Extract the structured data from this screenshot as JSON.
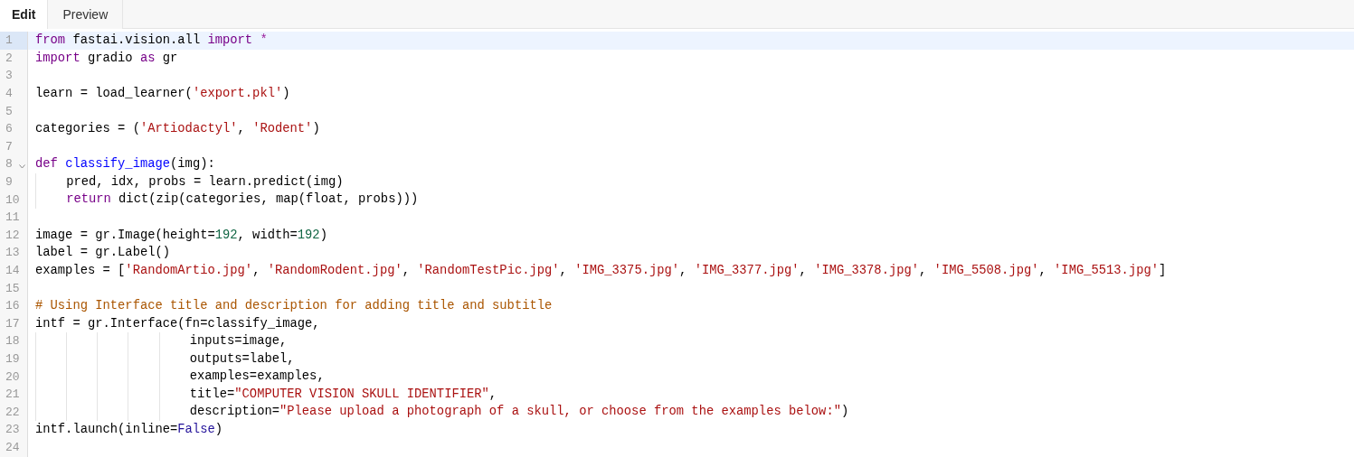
{
  "tabs": [
    {
      "label": "Edit",
      "selected": true
    },
    {
      "label": "Preview",
      "selected": false
    }
  ],
  "editor": {
    "lines": [
      {
        "number": "1",
        "active": true,
        "foldable": false,
        "tokens": [
          {
            "t": "from",
            "kind": "keyword"
          },
          {
            "t": " fastai.vision.all ",
            "kind": "plain"
          },
          {
            "t": "import",
            "kind": "keyword"
          },
          {
            "t": " *",
            "kind": "operator"
          }
        ]
      },
      {
        "number": "2",
        "active": false,
        "foldable": false,
        "tokens": [
          {
            "t": "import",
            "kind": "keyword"
          },
          {
            "t": " gradio ",
            "kind": "plain"
          },
          {
            "t": "as",
            "kind": "keyword"
          },
          {
            "t": " gr",
            "kind": "plain"
          }
        ]
      },
      {
        "number": "3",
        "active": false,
        "foldable": false
      },
      {
        "number": "4",
        "active": false,
        "foldable": false,
        "tokens": [
          {
            "t": "learn = load_learner(",
            "kind": "plain"
          },
          {
            "t": "'export.pkl'",
            "kind": "string"
          },
          {
            "t": ")",
            "kind": "plain"
          }
        ]
      },
      {
        "number": "5",
        "active": false,
        "foldable": false
      },
      {
        "number": "6",
        "active": false,
        "foldable": false,
        "tokens": [
          {
            "t": "categories = (",
            "kind": "plain"
          },
          {
            "t": "'Artiodactyl'",
            "kind": "string"
          },
          {
            "t": ", ",
            "kind": "plain"
          },
          {
            "t": "'Rodent'",
            "kind": "string"
          },
          {
            "t": ")",
            "kind": "plain"
          }
        ]
      },
      {
        "number": "7",
        "active": false,
        "foldable": false
      },
      {
        "number": "8",
        "active": false,
        "foldable": true,
        "tokens": [
          {
            "t": "def ",
            "kind": "keyword"
          },
          {
            "t": "classify_image",
            "kind": "def"
          },
          {
            "t": "(img):",
            "kind": "plain"
          }
        ]
      },
      {
        "number": "9",
        "active": false,
        "foldable": false,
        "tokens": [
          {
            "t": "    pred, idx, probs = learn.predict(img)",
            "kind": "plain"
          }
        ]
      },
      {
        "number": "10",
        "active": false,
        "foldable": false,
        "tokens": [
          {
            "t": "    return",
            "kind": "keyword"
          },
          {
            "t": " dict(zip(categories, map(float, probs)))",
            "kind": "plain"
          }
        ]
      },
      {
        "number": "11",
        "active": false,
        "foldable": false
      },
      {
        "number": "12",
        "active": false,
        "foldable": false,
        "tokens": [
          {
            "t": "image = gr.Image(height=",
            "kind": "plain"
          },
          {
            "t": "192",
            "kind": "number"
          },
          {
            "t": ", width=",
            "kind": "plain"
          },
          {
            "t": "192",
            "kind": "number"
          },
          {
            "t": ")",
            "kind": "plain"
          }
        ]
      },
      {
        "number": "13",
        "active": false,
        "foldable": false,
        "tokens": [
          {
            "t": "label = gr.Label()",
            "kind": "plain"
          }
        ]
      },
      {
        "number": "14",
        "active": false,
        "foldable": false,
        "tokens": [
          {
            "t": "examples = [",
            "kind": "plain"
          },
          {
            "t": "'RandomArtio.jpg'",
            "kind": "string"
          },
          {
            "t": ", ",
            "kind": "plain"
          },
          {
            "t": "'RandomRodent.jpg'",
            "kind": "string"
          },
          {
            "t": ", ",
            "kind": "plain"
          },
          {
            "t": "'RandomTestPic.jpg'",
            "kind": "string"
          },
          {
            "t": ", ",
            "kind": "plain"
          },
          {
            "t": "'IMG_3375.jpg'",
            "kind": "string"
          },
          {
            "t": ", ",
            "kind": "plain"
          },
          {
            "t": "'IMG_3377.jpg'",
            "kind": "string"
          },
          {
            "t": ", ",
            "kind": "plain"
          },
          {
            "t": "'IMG_3378.jpg'",
            "kind": "string"
          },
          {
            "t": ", ",
            "kind": "plain"
          },
          {
            "t": "'IMG_5508.jpg'",
            "kind": "string"
          },
          {
            "t": ", ",
            "kind": "plain"
          },
          {
            "t": "'IMG_5513.jpg'",
            "kind": "string"
          },
          {
            "t": "]",
            "kind": "plain"
          }
        ]
      },
      {
        "number": "15",
        "active": false,
        "foldable": false
      },
      {
        "number": "16",
        "active": false,
        "foldable": false,
        "tokens": [
          {
            "t": "# Using Interface title and description for adding title and subtitle",
            "kind": "comment"
          }
        ]
      },
      {
        "number": "17",
        "active": false,
        "foldable": false,
        "tokens": [
          {
            "t": "intf = gr.Interface(fn=classify_image,",
            "kind": "plain"
          }
        ]
      },
      {
        "number": "18",
        "active": false,
        "foldable": false,
        "tokens": [
          {
            "t": "                    inputs=image,",
            "kind": "plain"
          }
        ]
      },
      {
        "number": "19",
        "active": false,
        "foldable": false,
        "tokens": [
          {
            "t": "                    outputs=label,",
            "kind": "plain"
          }
        ]
      },
      {
        "number": "20",
        "active": false,
        "foldable": false,
        "tokens": [
          {
            "t": "                    examples=examples,",
            "kind": "plain"
          }
        ]
      },
      {
        "number": "21",
        "active": false,
        "foldable": false,
        "tokens": [
          {
            "t": "                    title=",
            "kind": "plain"
          },
          {
            "t": "\"COMPUTER VISION SKULL IDENTIFIER\"",
            "kind": "string"
          },
          {
            "t": ",",
            "kind": "plain"
          }
        ]
      },
      {
        "number": "22",
        "active": false,
        "foldable": false,
        "tokens": [
          {
            "t": "                    description=",
            "kind": "plain"
          },
          {
            "t": "\"Please upload a photograph of a skull, or choose from the examples below:\"",
            "kind": "string"
          },
          {
            "t": ")",
            "kind": "plain"
          }
        ]
      },
      {
        "number": "23",
        "active": false,
        "foldable": false,
        "tokens": [
          {
            "t": "intf.launch(inline=",
            "kind": "plain"
          },
          {
            "t": "False",
            "kind": "atom"
          },
          {
            "t": ")",
            "kind": "plain"
          }
        ]
      },
      {
        "number": "24",
        "active": false,
        "foldable": false
      }
    ]
  }
}
